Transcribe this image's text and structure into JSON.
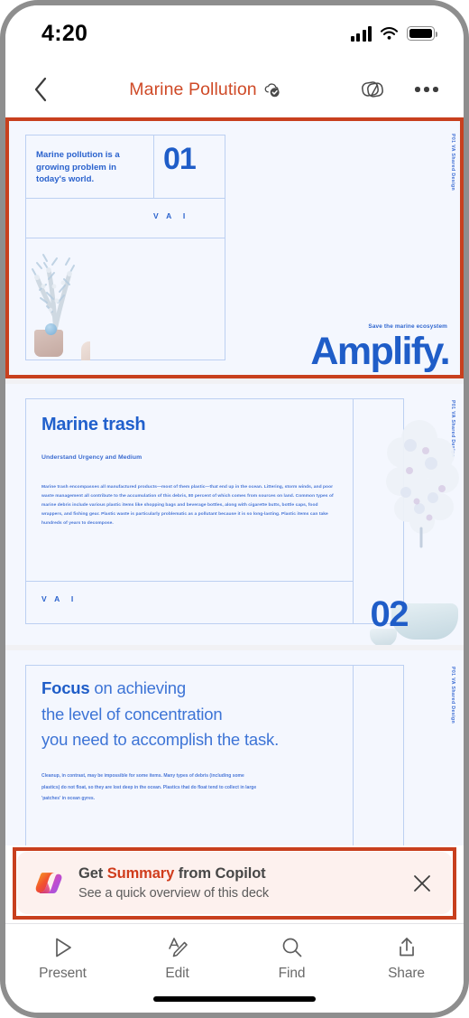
{
  "status_bar": {
    "time": "4:20",
    "signal_icon": "cellular-signal-icon",
    "wifi_icon": "wifi-icon",
    "battery_icon": "battery-icon"
  },
  "nav_bar": {
    "back_icon": "chevron-left-icon",
    "title": "Marine Pollution",
    "sync_icon": "cloud-check-icon",
    "slides_icon": "slide-layout-icon",
    "more_icon": "more-options-icon",
    "title_color": "#cf4a27"
  },
  "deck": {
    "accent_blue": "#1f5dc8",
    "slide_background": "#f4f7fe",
    "slides": [
      {
        "number": "01",
        "side_label": "P01  VA Shared Design",
        "lead_text": "Marine pollution is a growing problem in today's world.",
        "brand_mark": "VAI",
        "tagline": "Save the marine ecosystem",
        "wordmark": "Amplify.",
        "selected": true
      },
      {
        "number": "02",
        "side_label": "P01  VA Shared Design",
        "title": "Marine trash",
        "subtitle": "Understand Urgency and Medium",
        "body": "Marine trash encompasses all manufactured products—most of them plastic—that end up in the ocean. Littering, storm winds, and poor waste management all contribute to the accumulation of this debris, 80 percent of which comes from sources on land. Common types of marine debris include various plastic items like shopping bags and beverage bottles, along with cigarette butts, bottle caps, food wrappers, and fishing gear. Plastic waste is particularly problematic as a pollutant because it is so long-lasting. Plastic items can take hundreds of years to decompose.",
        "brand_mark": "VAI",
        "selected": false
      },
      {
        "side_label": "P01  VA Shared Design",
        "heading_bold": "Focus",
        "heading_rest_line1": " on achieving",
        "heading_line2": "the level of concentration",
        "heading_line3": "you need to accomplish the task.",
        "body": "Cleanup, in contrast, may be impossible for some items. Many types of debris (including some plastics) do not float, so they are lost deep in the ocean. Plastics that do float tend to collect in large 'patches' in ocean gyres.",
        "selected": false
      }
    ]
  },
  "copilot_banner": {
    "logo_icon": "copilot-logo-icon",
    "title_prefix": "Get ",
    "title_highlight": "Summary",
    "title_suffix": " from Copilot",
    "subtitle": "See a quick overview of this deck",
    "close_icon": "close-icon",
    "background": "#fdf1ee",
    "highlight_color": "#d03c1c",
    "selected": true
  },
  "toolbar": {
    "items": [
      {
        "label": "Present",
        "icon": "play-triangle-icon"
      },
      {
        "label": "Edit",
        "icon": "edit-pen-icon"
      },
      {
        "label": "Find",
        "icon": "search-icon"
      },
      {
        "label": "Share",
        "icon": "share-upload-icon"
      }
    ]
  },
  "annotations": {
    "highlight_color": "#c8401e"
  }
}
